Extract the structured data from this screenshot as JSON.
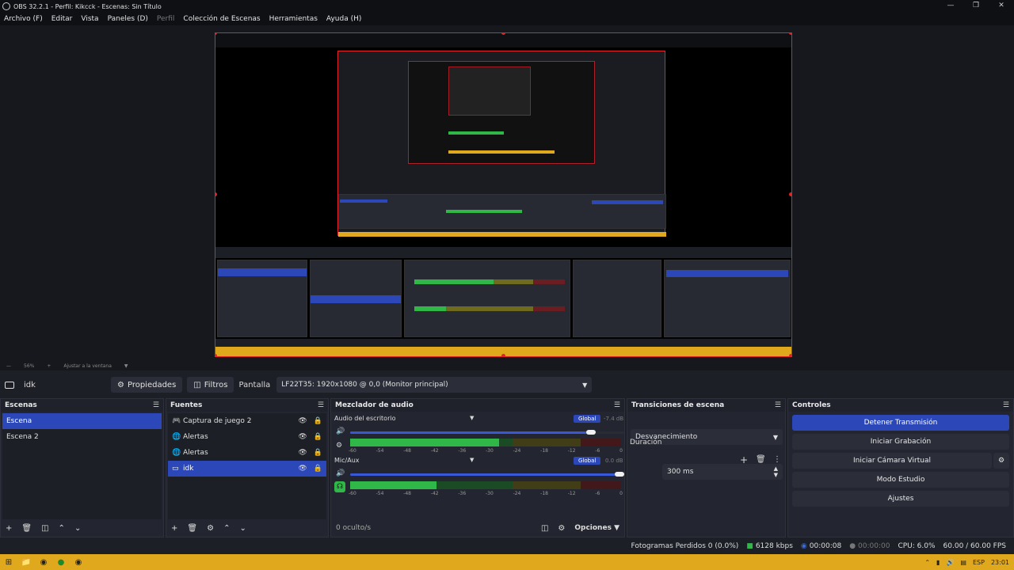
{
  "window": {
    "title": "OBS 32.2.1 - Perfil: Kikcck - Escenas: Sin Título"
  },
  "menu": [
    "Archivo (F)",
    "Editar",
    "Vista",
    "Paneles (D)",
    "Perfil",
    "Colección de Escenas",
    "Herramientas",
    "Ayuda (H)"
  ],
  "zoom": {
    "value": "56%",
    "fit": "Ajustar a la ventana"
  },
  "source_toolbar": {
    "selected_source": "idk",
    "properties": "Propiedades",
    "filters": "Filtros",
    "display_label": "Pantalla",
    "display_value": "LF22T35: 1920x1080 @ 0,0 (Monitor principal)"
  },
  "scenes": {
    "title": "Escenas",
    "items": [
      "Escena",
      "Escena 2"
    ],
    "selected": "Escena"
  },
  "sources": {
    "title": "Fuentes",
    "items": [
      {
        "name": "Captura de juego 2",
        "icon": "gamepad-icon"
      },
      {
        "name": "Alertas",
        "icon": "globe-icon"
      },
      {
        "name": "Alertas",
        "icon": "globe-icon"
      },
      {
        "name": "idk",
        "icon": "monitor-icon"
      }
    ],
    "selected": "idk"
  },
  "mixer": {
    "title": "Mezclador de audio",
    "channels": [
      {
        "name": "Audio del escritorio",
        "db": "-7.4 dB",
        "global": "Global",
        "volume": 0.88,
        "level": 0.55
      },
      {
        "name": "Mic/Aux",
        "db": "0.0 dB",
        "global": "Global",
        "volume": 1.0,
        "level": 0.32
      }
    ],
    "scale": [
      "-60",
      "-54",
      "-48",
      "-42",
      "-36",
      "-30",
      "-24",
      "-18",
      "-12",
      "-6",
      "0"
    ],
    "hidden": "0 oculto/s",
    "options": "Opciones"
  },
  "transitions": {
    "title": "Transiciones de escena",
    "type": "Desvanecimiento",
    "duration_label": "Duración",
    "duration_value": "300 ms"
  },
  "controls": {
    "title": "Controles",
    "stop_stream": "Detener Transmisión",
    "start_recording": "Iniciar Grabación",
    "start_virtual_cam": "Iniciar Cámara Virtual",
    "studio_mode": "Modo Estudio",
    "settings": "Ajustes"
  },
  "status": {
    "dropped": "Fotogramas Perdidos 0 (0.0%)",
    "bitrate": "6128 kbps",
    "stream_time": "00:00:08",
    "rec_time": "00:00:00",
    "cpu": "CPU: 6.0%",
    "fps": "60.00 / 60.00 FPS"
  },
  "taskbar": {
    "lang": "ESP",
    "time": "23:01"
  },
  "colors": {
    "accent": "#2b47b8",
    "selection_red": "#e0242a",
    "taskbar": "#e0a81c",
    "meter_green": "#2fb847"
  }
}
